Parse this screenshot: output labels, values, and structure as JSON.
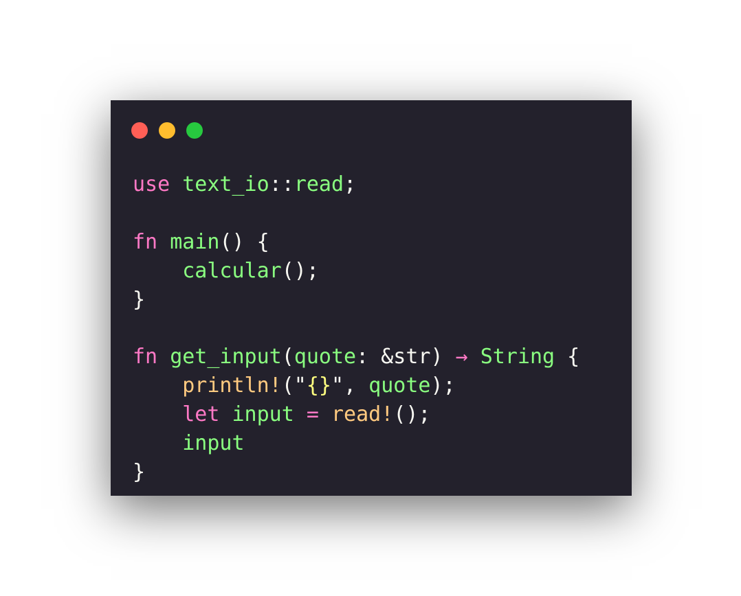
{
  "colors": {
    "background": "#23212c",
    "window_close": "#ff5f56",
    "window_minimize": "#ffbd2e",
    "window_zoom": "#27c93f",
    "keyword": "#ff79c6",
    "identifier": "#8aff80",
    "macro": "#ffca80",
    "plain": "#f8f8f2",
    "format_braces": "#ffff80"
  },
  "window_controls": [
    "close-icon",
    "minimize-icon",
    "zoom-icon"
  ],
  "code": [
    [
      {
        "t": "use",
        "c": "keyword"
      },
      {
        "t": " ",
        "c": "plain"
      },
      {
        "t": "text_io",
        "c": "identifier"
      },
      {
        "t": "::",
        "c": "plain"
      },
      {
        "t": "read",
        "c": "identifier"
      },
      {
        "t": ";",
        "c": "plain"
      }
    ],
    [],
    [
      {
        "t": "fn",
        "c": "keyword"
      },
      {
        "t": " ",
        "c": "plain"
      },
      {
        "t": "main",
        "c": "identifier"
      },
      {
        "t": "() {",
        "c": "plain"
      }
    ],
    [
      {
        "t": "    ",
        "c": "plain"
      },
      {
        "t": "calcular",
        "c": "identifier"
      },
      {
        "t": "();",
        "c": "plain"
      }
    ],
    [
      {
        "t": "}",
        "c": "plain"
      }
    ],
    [],
    [
      {
        "t": "fn",
        "c": "keyword"
      },
      {
        "t": " ",
        "c": "plain"
      },
      {
        "t": "get_input",
        "c": "identifier"
      },
      {
        "t": "(",
        "c": "plain"
      },
      {
        "t": "quote",
        "c": "identifier"
      },
      {
        "t": ": &str) ",
        "c": "plain"
      },
      {
        "t": "→",
        "c": "keyword"
      },
      {
        "t": " ",
        "c": "plain"
      },
      {
        "t": "String",
        "c": "identifier"
      },
      {
        "t": " {",
        "c": "plain"
      }
    ],
    [
      {
        "t": "    ",
        "c": "plain"
      },
      {
        "t": "println!",
        "c": "macro"
      },
      {
        "t": "(\"",
        "c": "plain"
      },
      {
        "t": "{}",
        "c": "format_braces"
      },
      {
        "t": "\", ",
        "c": "plain"
      },
      {
        "t": "quote",
        "c": "identifier"
      },
      {
        "t": ");",
        "c": "plain"
      }
    ],
    [
      {
        "t": "    ",
        "c": "plain"
      },
      {
        "t": "let",
        "c": "keyword"
      },
      {
        "t": " ",
        "c": "plain"
      },
      {
        "t": "input",
        "c": "identifier"
      },
      {
        "t": " ",
        "c": "plain"
      },
      {
        "t": "=",
        "c": "keyword"
      },
      {
        "t": " ",
        "c": "plain"
      },
      {
        "t": "read!",
        "c": "macro"
      },
      {
        "t": "();",
        "c": "plain"
      }
    ],
    [
      {
        "t": "    ",
        "c": "plain"
      },
      {
        "t": "input",
        "c": "identifier"
      }
    ],
    [
      {
        "t": "}",
        "c": "plain"
      }
    ]
  ]
}
